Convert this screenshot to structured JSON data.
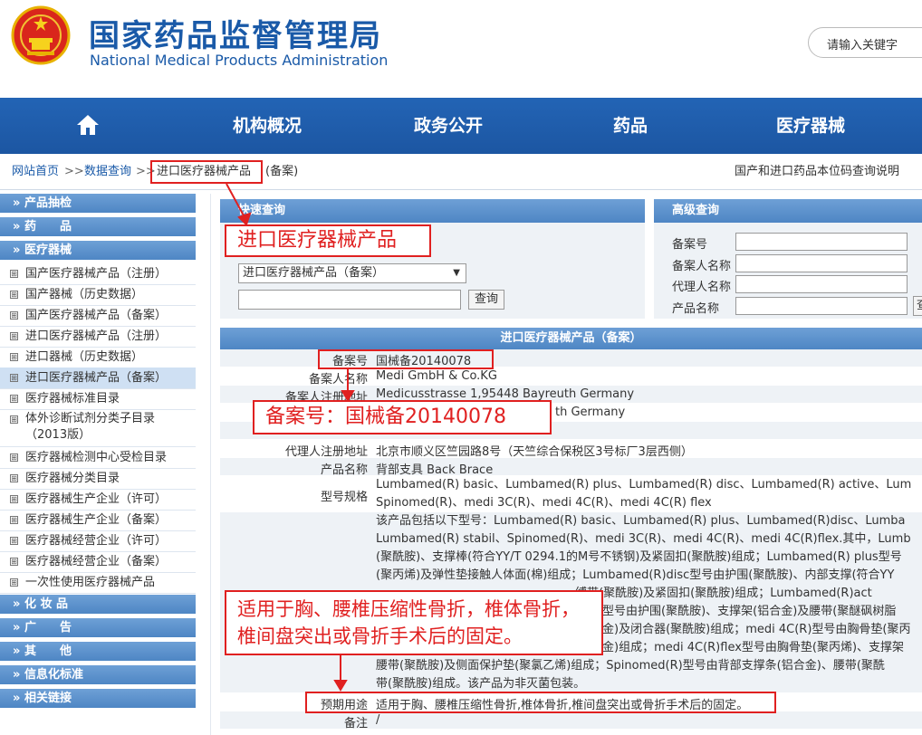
{
  "header": {
    "title_cn": "国家药品监督管理局",
    "title_en": "National Medical Products Administration",
    "search_placeholder": "请输入关键字"
  },
  "nav": [
    "机构概况",
    "政务公开",
    "药品",
    "医疗器械"
  ],
  "breadcrumb": {
    "home": "网站首页",
    "sep": ">>",
    "data_query": "数据查询",
    "current": "进口医疗器械产品",
    "suffix": "(备案)",
    "right_link": "国产和进口药品本位码查询说明"
  },
  "sidebar": {
    "sections": [
      "产品抽检",
      "药　　品",
      "医疗器械",
      "化 妆 品",
      "广　　告",
      "其　　他",
      "信息化标准",
      "相关链接"
    ],
    "items": [
      "国产医疗器械产品（注册）",
      "国产器械（历史数据）",
      "国产医疗器械产品（备案）",
      "进口医疗器械产品（注册）",
      "进口器械（历史数据）",
      "进口医疗器械产品（备案）",
      "医疗器械标准目录",
      "体外诊断试剂分类子目录",
      "（2013版）",
      "医疗器械检测中心受检目录",
      "医疗器械分类目录",
      "医疗器械生产企业（许可）",
      "医疗器械生产企业（备案）",
      "医疗器械经营企业（许可）",
      "医疗器械经营企业（备案）",
      "一次性使用医疗器械产品"
    ],
    "expand_mark": "⊞"
  },
  "quick": {
    "title": "快速查询",
    "select_value": "进口医疗器械产品（备案）",
    "button": "查询"
  },
  "advanced": {
    "title": "高级查询",
    "labels": [
      "备案号",
      "备案人名称",
      "代理人名称",
      "产品名称"
    ],
    "button": "查"
  },
  "detail": {
    "title": "进口医疗器械产品（备案）",
    "rows": [
      {
        "label": "备案号",
        "value": "国械备20140078"
      },
      {
        "label": "备案人名称",
        "value": "Medi GmbH & Co.KG"
      },
      {
        "label": "备案人注册地址",
        "value": "Medicusstrasse 1,95448 Bayreuth Germany"
      },
      {
        "label": "",
        "value": "th Germany"
      },
      {
        "label": "代理人注册地址",
        "value": "北京市顺义区竺园路8号（天竺综合保税区3号标厂3层西侧）"
      },
      {
        "label": "产品名称",
        "value": "背部支具 Back Brace"
      }
    ],
    "model_label": "型号规格",
    "model_lines": [
      "Lumbamed(R) basic、Lumbamed(R) plus、Lumbamed(R) disc、Lumbamed(R) active、Lum",
      "Spinomed(R)、medi 3C(R)、medi 4C(R)、medi 4C(R) flex"
    ],
    "desc_lines": [
      "该产品包括以下型号：Lumbamed(R) basic、Lumbamed(R) plus、Lumbamed(R)disc、Lumba",
      "Lumbamed(R) stabil、Spinomed(R)、medi 3C(R)、medi 4C(R)、medi 4C(R)flex.其中，Lumb",
      "(聚酰胺)、支撑棒(符合YY/T 0294.1的M号不锈钢)及紧固扣(聚酰胺)组成；Lumbamed(R) plus型号",
      "(聚丙烯)及弹性垫接触人体面(棉)组成；Lumbamed(R)disc型号由护围(聚酰胺)、内部支撑(符合YY",
      "缚带(聚酰胺)及紧固扣(聚酰胺)组成；Lumbamed(R)act",
      "型号由护围(聚酰胺)、支撑架(铝合金)及腰带(聚醚砜树脂",
      "金)及闭合器(聚酰胺)组成；medi 4C(R)型号由胸骨垫(聚丙",
      "金)组成；medi 4C(R)flex型号由胸骨垫(聚丙烯)、支撑架",
      "腰带(聚酰胺)及侧面保护垫(聚氯乙烯)组成；Spinomed(R)型号由背部支撑条(铝合金)、腰带(聚酰",
      "带(聚酰胺)组成。该产品为非灭菌包装。"
    ],
    "use_label": "预期用途",
    "use_value": "适用于胸、腰椎压缩性骨折,椎体骨折,椎间盘突出或骨折手术后的固定。",
    "note_label": "备注",
    "note_value": "/"
  },
  "annotations": {
    "product": "进口医疗器械产品",
    "record_no": "备案号：国械备20140078",
    "use_line1": "适用于胸、腰椎压缩性骨折，椎体骨折，",
    "use_line2": "椎间盘突出或骨折手术后的固定。"
  },
  "colors": {
    "brand": "#1a5aa8",
    "nav": "#1c56a2",
    "annotation": "#e02020"
  }
}
